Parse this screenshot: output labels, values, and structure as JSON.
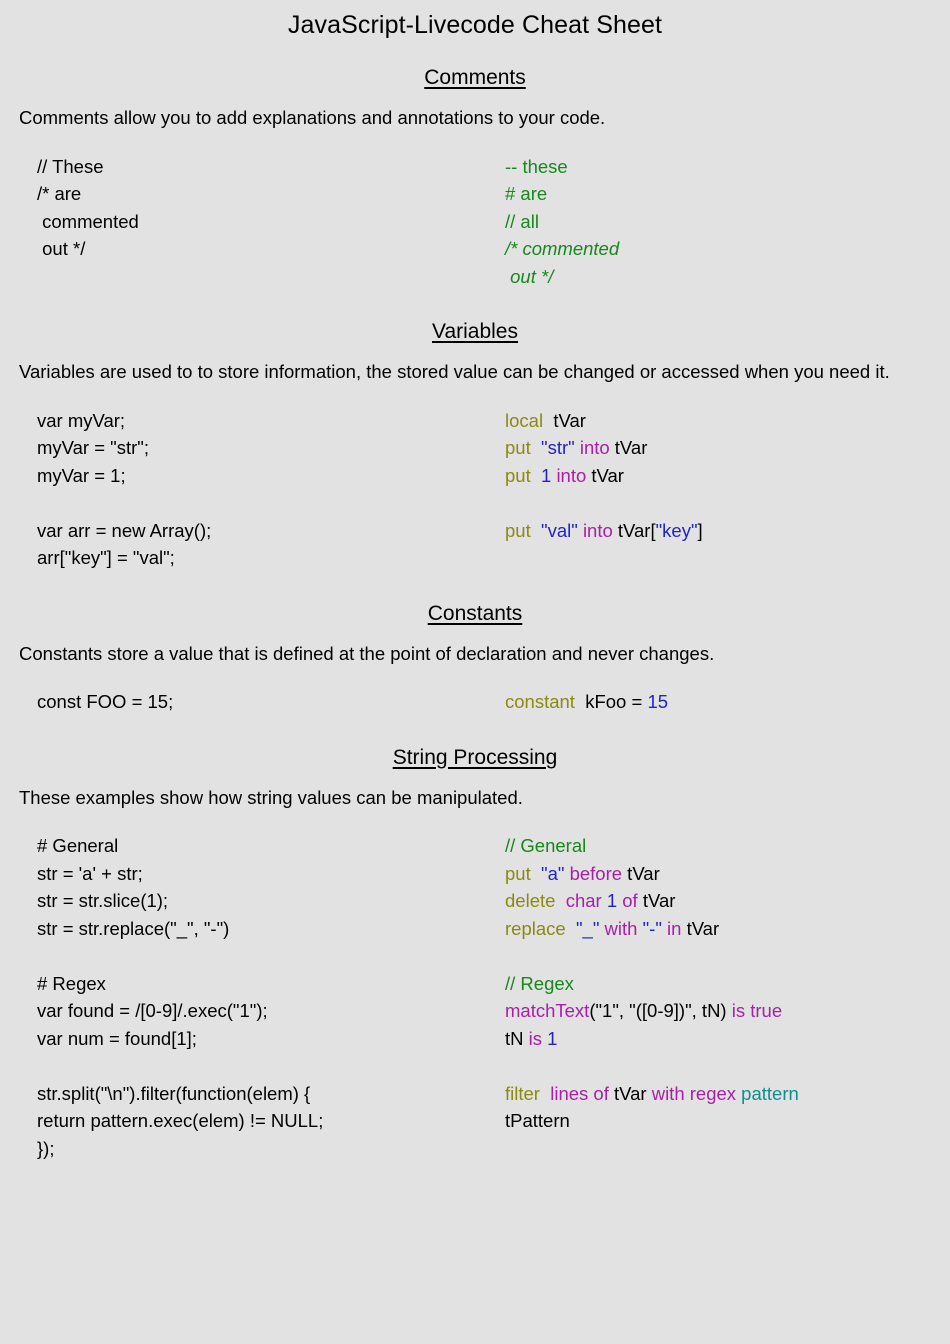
{
  "document": {
    "title": "JavaScript-Livecode Cheat Sheet",
    "background_color": "#e2e2e2",
    "text_color": "#000000"
  },
  "syntax_colors": {
    "comment": "#18871c",
    "keyword": "#8a8a12",
    "string": "#2222cc",
    "number": "#2222cc",
    "operator": "#a91fa9",
    "function": "#a91fa9",
    "identifier": "#000000",
    "teal": "#0e8e8e"
  },
  "sections": [
    {
      "heading": "Comments",
      "description": "Comments allow you to add explanations and annotations to your code.",
      "left_lines": [
        "// These",
        "/* are",
        " commented",
        " out */"
      ],
      "right_lines": [
        "-- these",
        "# are",
        "// all",
        "/* commented",
        " out */"
      ]
    },
    {
      "heading": "Variables",
      "description": "Variables are used to to store information, the stored value can be changed or accessed when you need it.",
      "left_lines": [
        "var myVar;",
        "myVar = \"str\";",
        "myVar = 1;",
        "",
        "var arr = new Array();",
        "arr[\"key\"] = \"val\";"
      ],
      "right_lines": [
        "local  tVar",
        "put  \"str\" into tVar",
        "put  1 into tVar",
        "",
        "put  \"val\" into tVar[\"key\"]"
      ]
    },
    {
      "heading": "Constants",
      "description": "Constants store a value that is defined at the point of declaration and never changes.",
      "left_lines": [
        "const FOO = 15;"
      ],
      "right_lines": [
        "constant  kFoo = 15"
      ]
    },
    {
      "heading": "String Processing",
      "description": "These examples show how string values can be manipulated.",
      "left_lines": [
        "# General",
        "str = 'a' + str;",
        "str = str.slice(1);",
        "str = str.replace(\"_\", \"-\")",
        "",
        "# Regex",
        "var found = /[0-9]/.exec(\"1\");",
        "var num = found[1];",
        "",
        "str.split(\"\\n\").filter(function(elem) {",
        "return pattern.exec(elem) != NULL;",
        "});"
      ],
      "right_lines": [
        "// General",
        "put  \"a\" before tVar",
        "delete  char 1 of tVar",
        "replace  \"_\" with \"-\" in tVar",
        "",
        "// Regex",
        "matchText(\"1\", \"([0-9])\", tN) is true",
        "tN is 1",
        "",
        "filter  lines of tVar with regex pattern",
        "tPattern"
      ]
    }
  ]
}
